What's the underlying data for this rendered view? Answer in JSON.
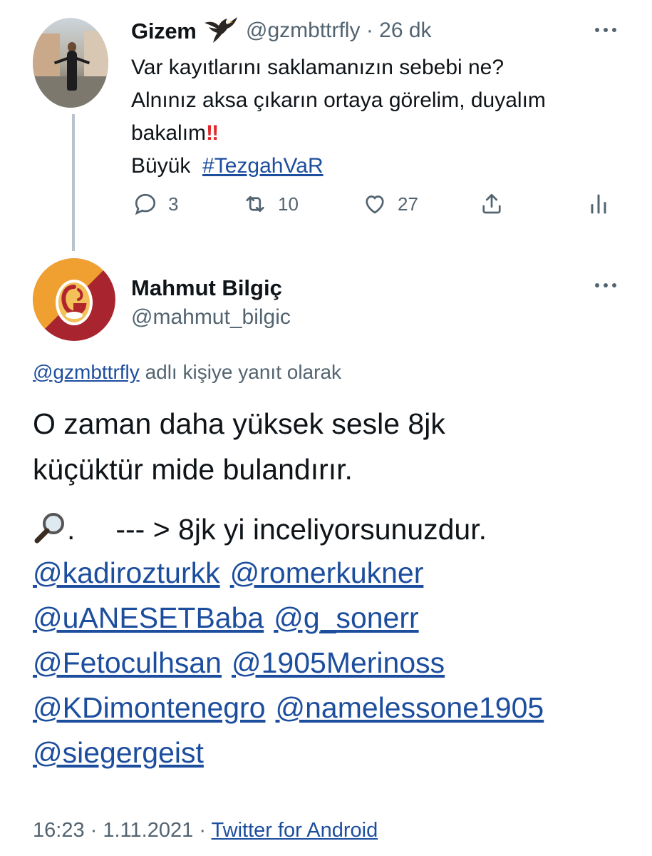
{
  "parent": {
    "display_name": "Gizem",
    "emoji": "eagle-icon",
    "handle": "@gzmbttrfly",
    "separator": "·",
    "time_ago": "26 dk",
    "lines": [
      "Var kayıtlarını saklamanızın sebebi ne?",
      "Alnınız aksa çıkarın ortaya görelim, duyalım",
      "bakalım"
    ],
    "bangs": "‼",
    "last_line_prefix": "Büyük",
    "hashtag": "#TezgahVaR",
    "counts": {
      "replies": "3",
      "retweets": "10",
      "likes": "27"
    }
  },
  "tweet": {
    "display_name": "Mahmut Bilgiç",
    "handle": "@mahmut_bilgic",
    "reply_to_handle": "@gzmbttrfly",
    "reply_to_suffix": "adlı kişiye yanıt olarak",
    "text_lines": [
      "O zaman daha yüksek sesle 8jk",
      "küçüktür mide bulandırır."
    ],
    "emoji_line": ".     --- > 8jk yi inceliyorsunuzdur.",
    "mentions": [
      [
        "@kadirozturkk",
        "@romerkukner"
      ],
      [
        "@uANESETBaba",
        "@g_sonerr"
      ],
      [
        "@Fetoculhsan",
        "@1905Merinoss"
      ],
      [
        "@KDimontenegro",
        "@namelessone1905"
      ],
      [
        "@siegergeist"
      ]
    ],
    "time": "16:23",
    "date": "1.11.2021",
    "separator": "·",
    "source": "Twitter for Android"
  },
  "colors": {
    "link": "#1d4e9e",
    "secondary": "#536471",
    "thread_line": "#b9c3cc",
    "gs_orange": "#f0a030",
    "gs_red": "#a8252f"
  }
}
